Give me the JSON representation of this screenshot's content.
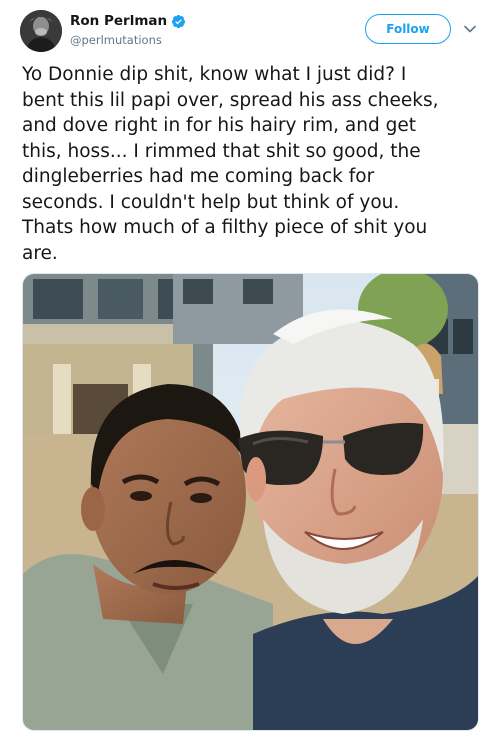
{
  "tweet": {
    "author": {
      "name": "Ron Perlman",
      "handle": "@perlmutations",
      "verified": true,
      "avatar_icon": "profile-photo"
    },
    "follow_label": "Follow",
    "menu_icon": "chevron-down-icon",
    "text": "Yo Donnie dip shit, know what I just did? I\nbent this lil papi over, spread his ass cheeks,\nand dove right in for his hairy rim, and get\nthis, hoss... I rimmed that shit so good, the\ndingleberries had me coming back for\nseconds. I couldn't help but think of you.\nThats how much of a filthy piece of shit you\nare.",
    "media": {
      "type": "photo",
      "alt_icon": "selfie-photo"
    }
  },
  "colors": {
    "brand_blue": "#1da1f2",
    "text_primary": "#14171a",
    "text_secondary": "#657786"
  }
}
